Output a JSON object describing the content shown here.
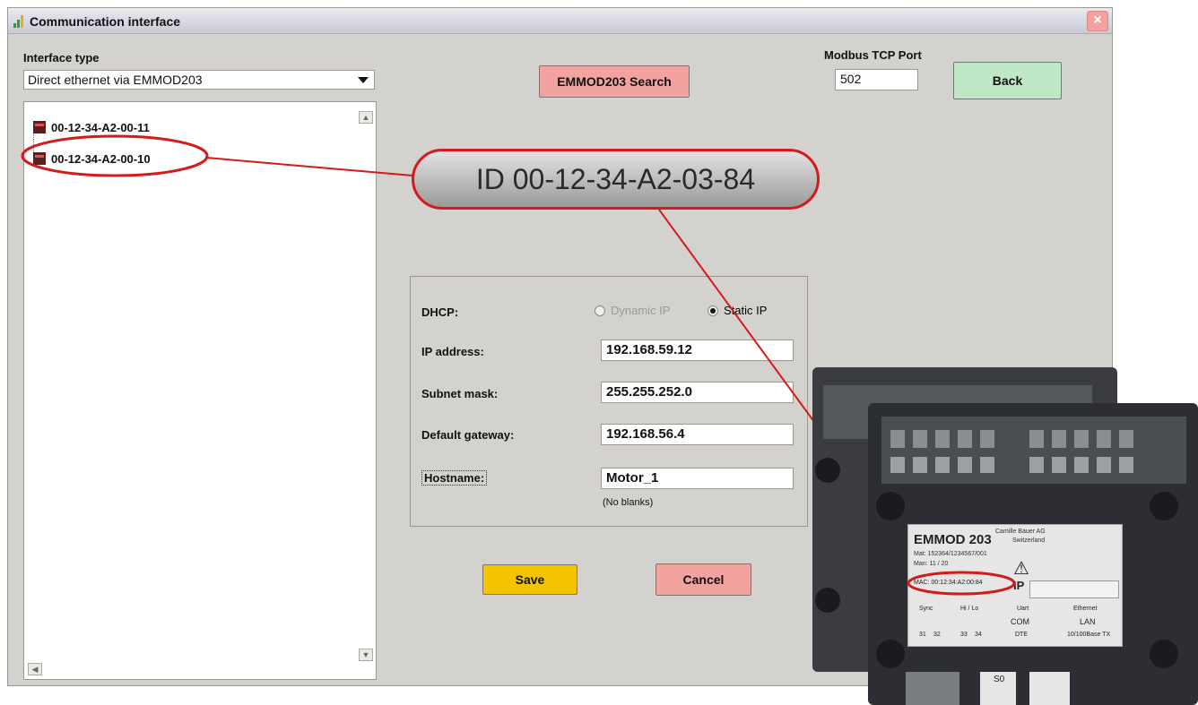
{
  "window": {
    "title": "Communication interface",
    "close_label": "×"
  },
  "interface_type": {
    "label": "Interface type",
    "value": "Direct ethernet via EMMOD203"
  },
  "search_button": "EMMOD203 Search",
  "modbus": {
    "label": "Modbus TCP Port",
    "value": "502"
  },
  "back_button": "Back",
  "tree": {
    "items": [
      {
        "label": "00-12-34-A2-00-11"
      },
      {
        "label": "00-12-34-A2-00-10"
      }
    ]
  },
  "callout": {
    "text": "ID 00-12-34-A2-03-84"
  },
  "form": {
    "dhcp_label": "DHCP:",
    "dynamic_label": "Dynamic IP",
    "static_label": "Static IP",
    "ip_label": "IP address:",
    "ip_value": "192.168.59.12",
    "subnet_label": "Subnet mask:",
    "subnet_value": "255.255.252.0",
    "gateway_label": "Default gateway:",
    "gateway_value": "192.168.56.4",
    "hostname_label": "Hostname:",
    "hostname_value": "Motor_1",
    "hostname_hint": "(No blanks)"
  },
  "save_button": "Save",
  "cancel_button": "Cancel",
  "device": {
    "model": "EMMOD 203",
    "maker": "Camille Bauer AG",
    "country": "Switzerland",
    "mat": "Mat: 152364/1234567/001",
    "man": "Man: 11 / 20",
    "mac": "MAC: 00:12:34:A2:00:84",
    "ip_label": "IP",
    "sync": "Sync",
    "hilo": "Hi / Lo",
    "uart": "Uart",
    "ethernet": "Ethernet",
    "com": "COM",
    "lan": "LAN",
    "dte": "DTE",
    "base": "10/100Base TX",
    "s0": "S0",
    "t31": "31",
    "t32": "32",
    "t33": "33",
    "t34": "34"
  },
  "colors": {
    "accent_red": "#d41a1a",
    "search_btn": "#f2a3a0",
    "back_btn": "#bfe8c6",
    "save_btn": "#f5c400",
    "cancel_btn": "#f2a3a0"
  }
}
